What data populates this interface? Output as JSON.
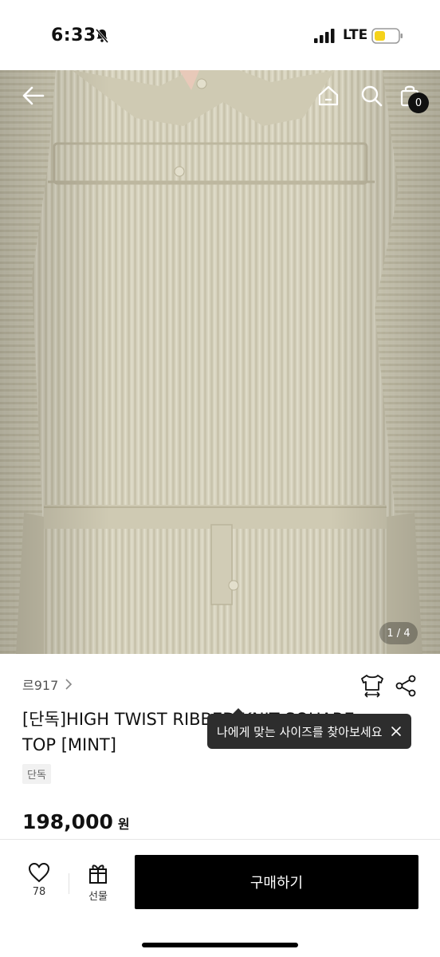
{
  "status_bar": {
    "time": "6:33",
    "network": "LTE",
    "icons": [
      "bell-slash-icon",
      "signal-icon",
      "battery-icon"
    ]
  },
  "hero": {
    "page_indicator": "1 / 4",
    "cart_count": "0",
    "icons": [
      "back-arrow-icon",
      "home-icon",
      "search-icon",
      "cart-icon"
    ]
  },
  "product": {
    "brand": "르917",
    "title": "[단독]HIGH TWIST RIBBED KNIT SQUARE TOP [MINT]",
    "tag": "단독",
    "price": "198,000",
    "currency": "원"
  },
  "tooltip": {
    "text": "나에게 맞는 사이즈를 찾아보세요"
  },
  "bottom_bar": {
    "like_count": "78",
    "gift_label": "선물",
    "buy_label": "구매하기"
  },
  "colors": {
    "knit": "#d7d3bf",
    "accent": "#000000",
    "battery_low": "#f5d21a"
  }
}
